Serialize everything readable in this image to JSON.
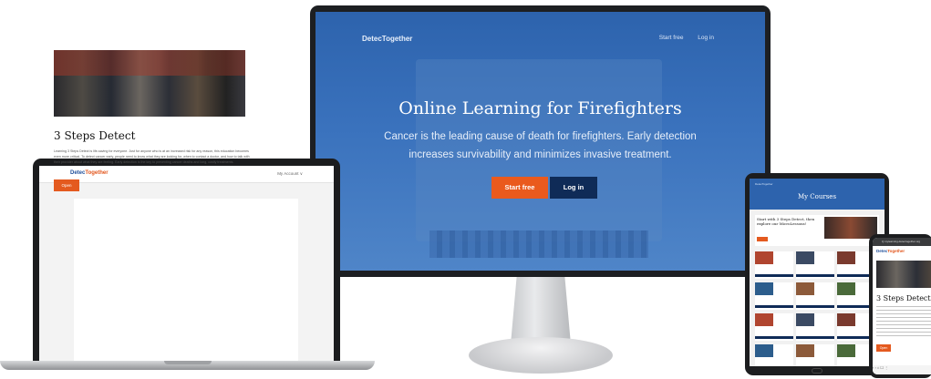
{
  "desktop": {
    "logo": "DetecTogether",
    "nav": [
      "Start free",
      "Log in"
    ],
    "hero_title": "Online Learning for Firefighters",
    "hero_subtitle": "Cancer is the leading cause of death for firefighters. Early detection increases survivability and minimizes invasive treatment.",
    "primary_button": "Start free",
    "secondary_button": "Log in"
  },
  "laptop": {
    "logo_a": "Detec",
    "logo_b": "Together",
    "account": "My Account ∨",
    "course_title": "3 Steps Detect",
    "course_text": "Learning 3 Steps Detect is life-saving for everyone. Just for anyone who is at an increased risk for any reason, this education becomes even more critical. To detect cancer early, people need to know what they are looking for, when to contact a doctor, and how to talk with their provider about what they are feeling. Early detection is the key to preventing cancer deaths and long, costly treatments.",
    "open_button": "Open"
  },
  "tablet": {
    "brand": "DetecTogether",
    "title": "My Courses",
    "feature_title": "Start with 3 Steps Detect, then explore our MicroLessons!",
    "tile_count": 12
  },
  "phone": {
    "url": "Q  mylearning.detectogether.org",
    "logo_a": "Detec",
    "logo_b": "Together",
    "course_title": "3 Steps Detect",
    "open_button": "Open",
    "nav_icons": "‹   ›   ⌂   ☐   ⋮"
  },
  "colors": {
    "brand_blue": "#2d63ad",
    "accent_orange": "#ea5a1d",
    "navy": "#0f2b57"
  }
}
